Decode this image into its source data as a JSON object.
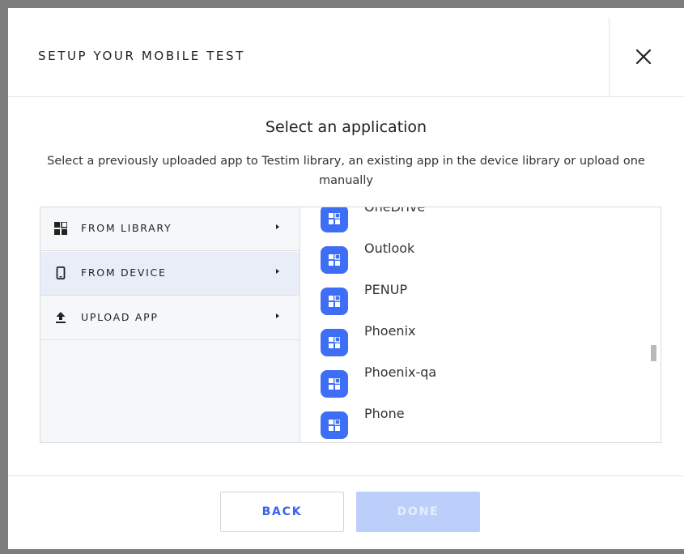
{
  "dialog": {
    "title": "SETUP YOUR MOBILE TEST",
    "heading": "Select an application",
    "subheading": "Select a previously uploaded app to Testim library, an existing app in the device library or upload one manually"
  },
  "sidebar": {
    "items": [
      {
        "label": "FROM LIBRARY",
        "icon": "grid-icon",
        "active": false
      },
      {
        "label": "FROM DEVICE",
        "icon": "phone-icon",
        "active": true
      },
      {
        "label": "UPLOAD APP",
        "icon": "upload-icon",
        "active": false
      }
    ]
  },
  "apps": [
    {
      "name": "OneDrive"
    },
    {
      "name": "Outlook"
    },
    {
      "name": "PENUP"
    },
    {
      "name": "Phoenix"
    },
    {
      "name": "Phoenix-qa"
    },
    {
      "name": "Phone"
    }
  ],
  "footer": {
    "back_label": "BACK",
    "done_label": "DONE",
    "done_disabled": true
  },
  "colors": {
    "accent": "#3a61f0",
    "app_icon": "#3d6ef5",
    "active_item": "#e8edf7",
    "disabled_button": "#bccffb"
  }
}
